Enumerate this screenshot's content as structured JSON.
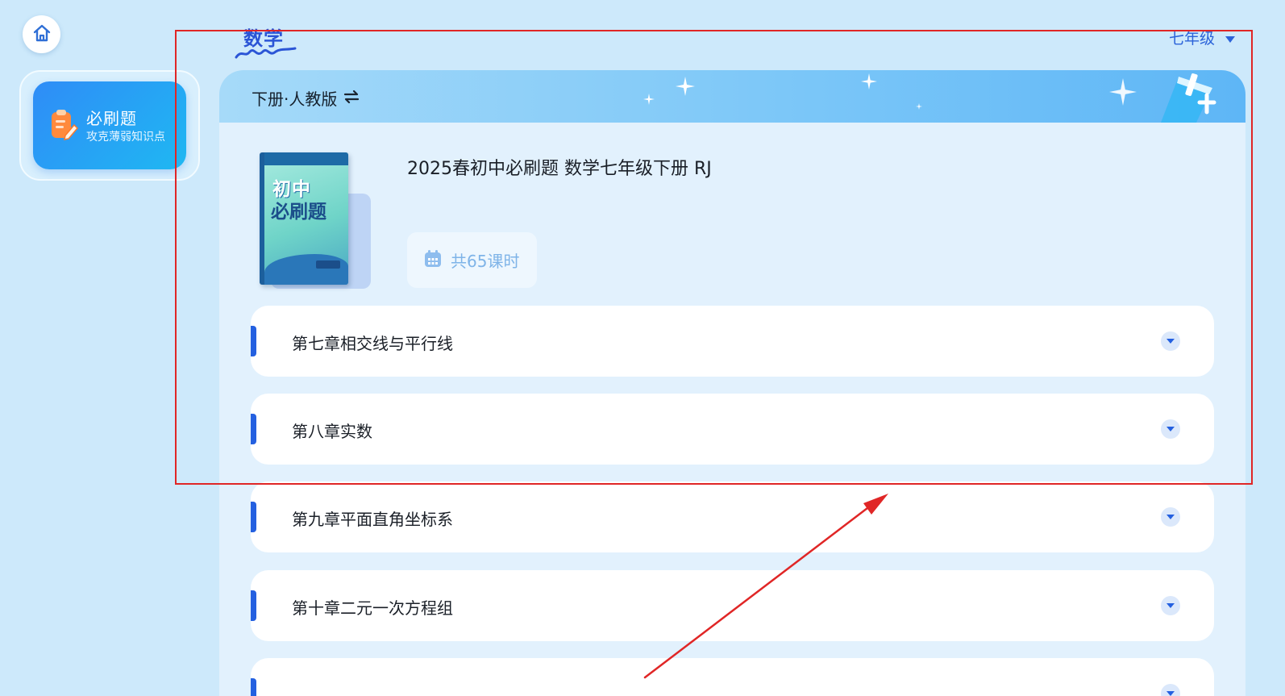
{
  "nav": {
    "home_icon": "home-icon"
  },
  "sidebar": {
    "card_title": "必刷题",
    "card_subtitle": "攻克薄弱知识点",
    "card_icon": "notepad-pencil-icon"
  },
  "header": {
    "subject": "数学",
    "grade": "七年级",
    "grade_icon": "caret-down-icon"
  },
  "banner": {
    "edition": "下册·人教版",
    "swap_icon": "swap-icon"
  },
  "book": {
    "title": "2025春初中必刷题 数学七年级下册 RJ",
    "cover_line1": "初中",
    "cover_line2": "必刷题",
    "lessons": "共65课时",
    "lessons_icon": "calendar-icon"
  },
  "chapters": [
    {
      "title": "第七章相交线与平行线"
    },
    {
      "title": "第八章实数"
    },
    {
      "title": "第九章平面直角坐标系"
    },
    {
      "title": "第十章二元一次方程组"
    },
    {
      "title": ""
    }
  ],
  "colors": {
    "background": "#cde9fb",
    "accent": "#2460e0",
    "annotation": "#e02626"
  }
}
